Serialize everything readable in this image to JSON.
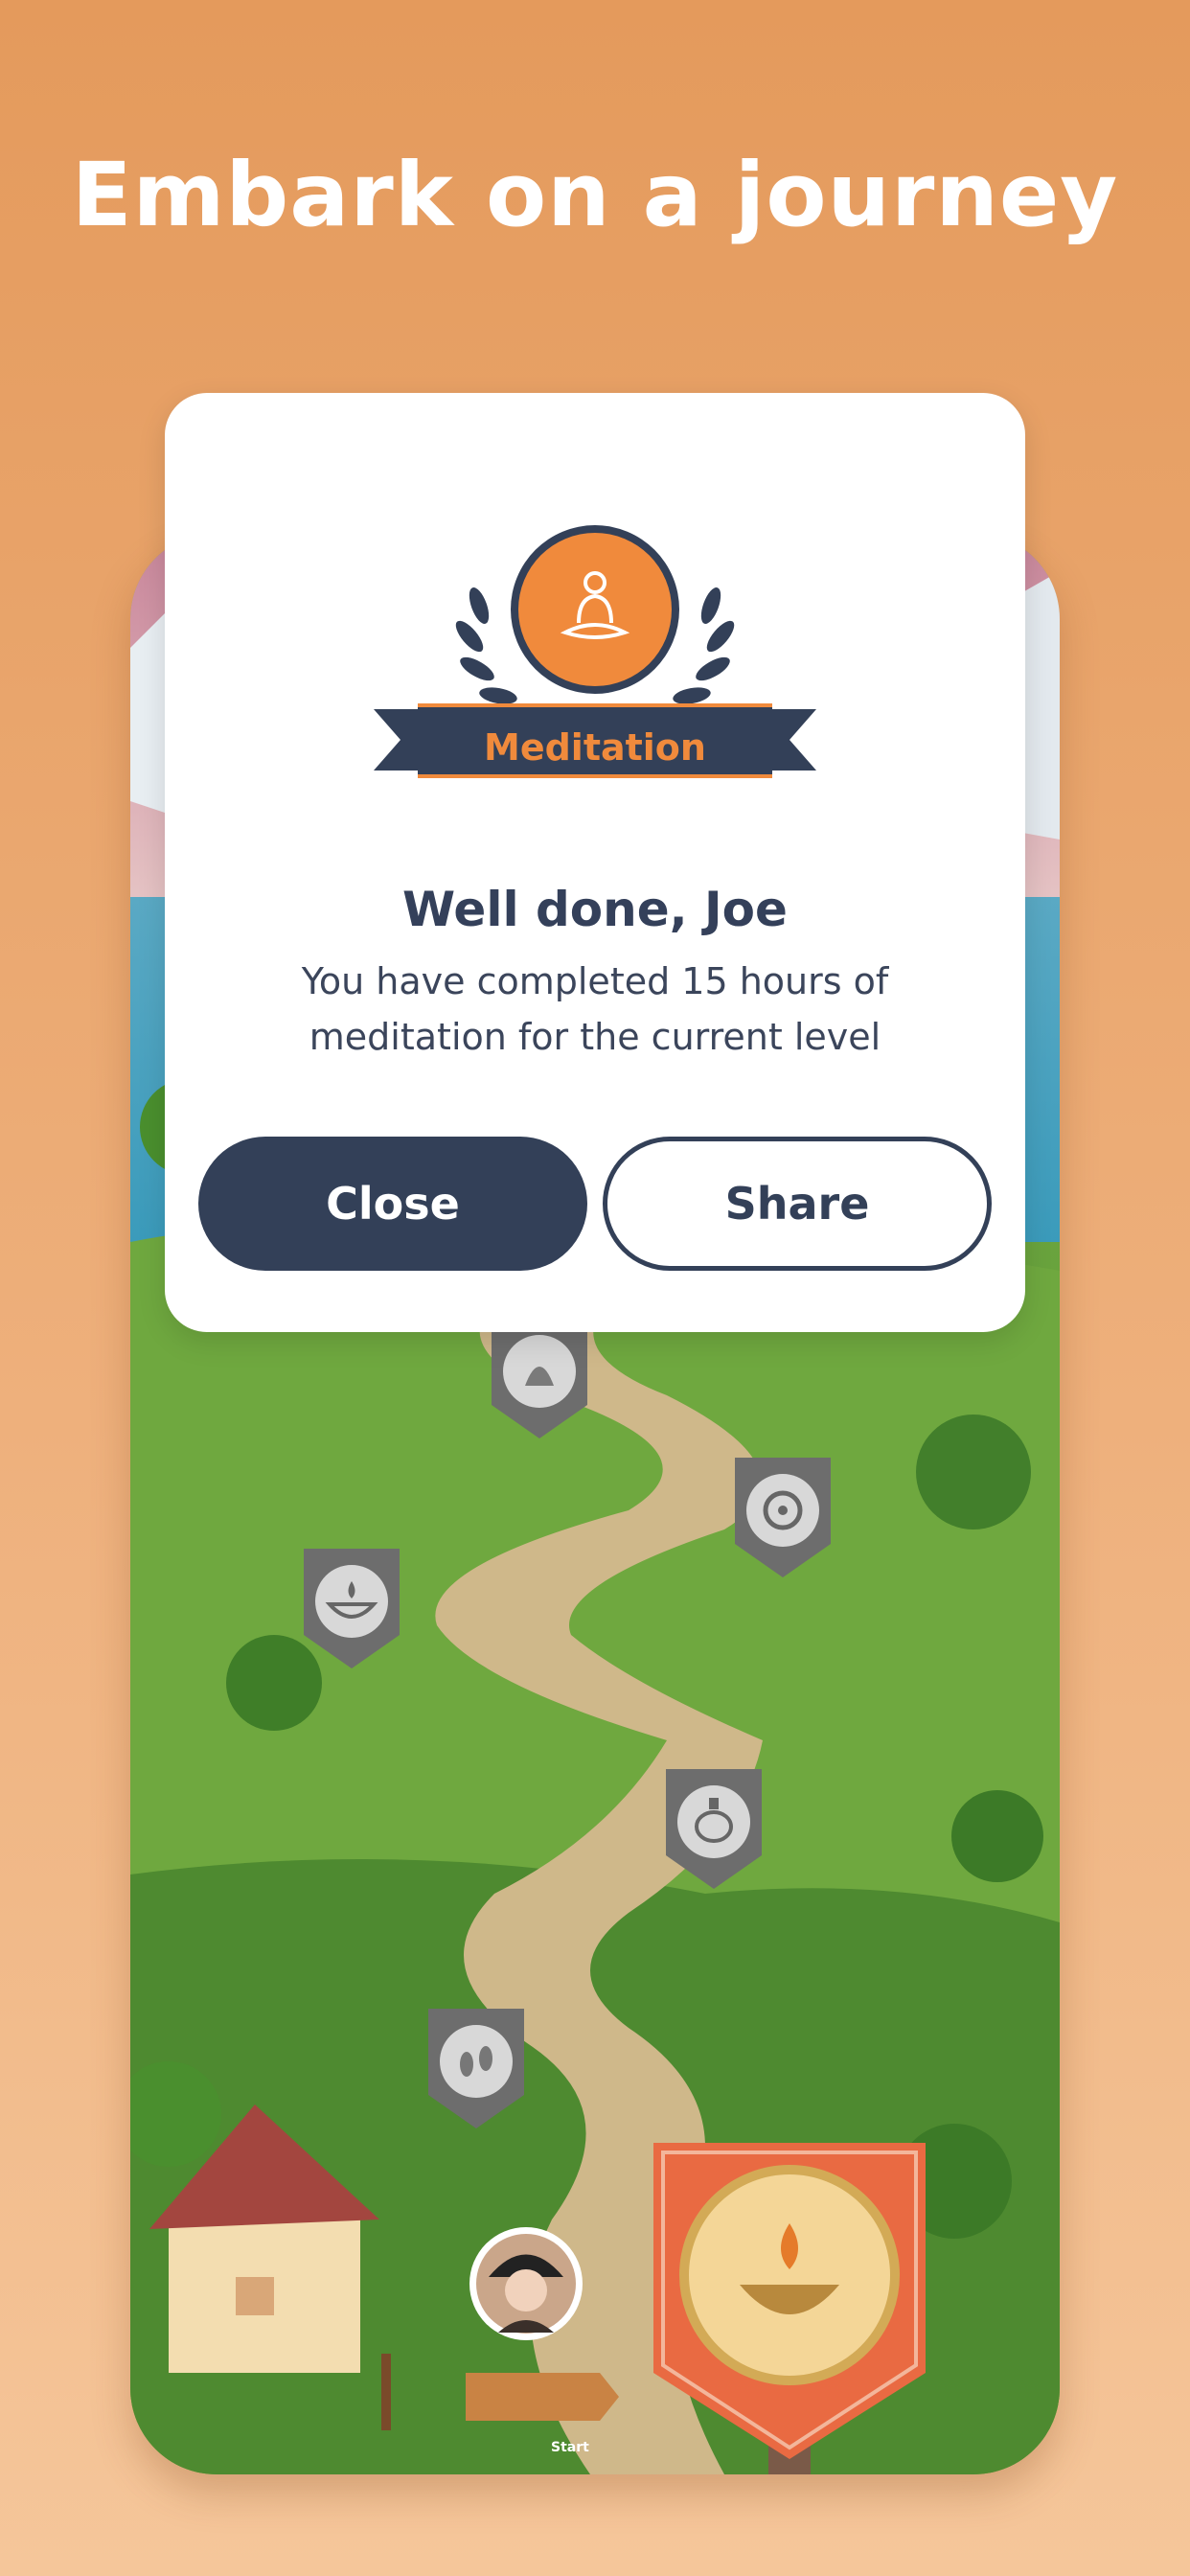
{
  "headline": "Embark on a journey",
  "modal": {
    "badge_label": "Meditation",
    "badge_icon": "meditation-icon",
    "title": "Well done, Joe",
    "message": "You have completed 15 hours of meditation for the current level",
    "close_label": "Close",
    "share_label": "Share"
  },
  "map": {
    "start_label": "Start",
    "milestones": [
      {
        "icon": "conch-shell-icon"
      },
      {
        "icon": "dharma-wheel-icon"
      },
      {
        "icon": "oil-lamp-icon"
      },
      {
        "icon": "treasure-vase-icon"
      },
      {
        "icon": "footprints-icon"
      }
    ],
    "current_milestone_icon": "oil-lamp-icon"
  },
  "colors": {
    "accent": "#f08a3c",
    "navy": "#334058",
    "current_banner": "#e96a42"
  }
}
